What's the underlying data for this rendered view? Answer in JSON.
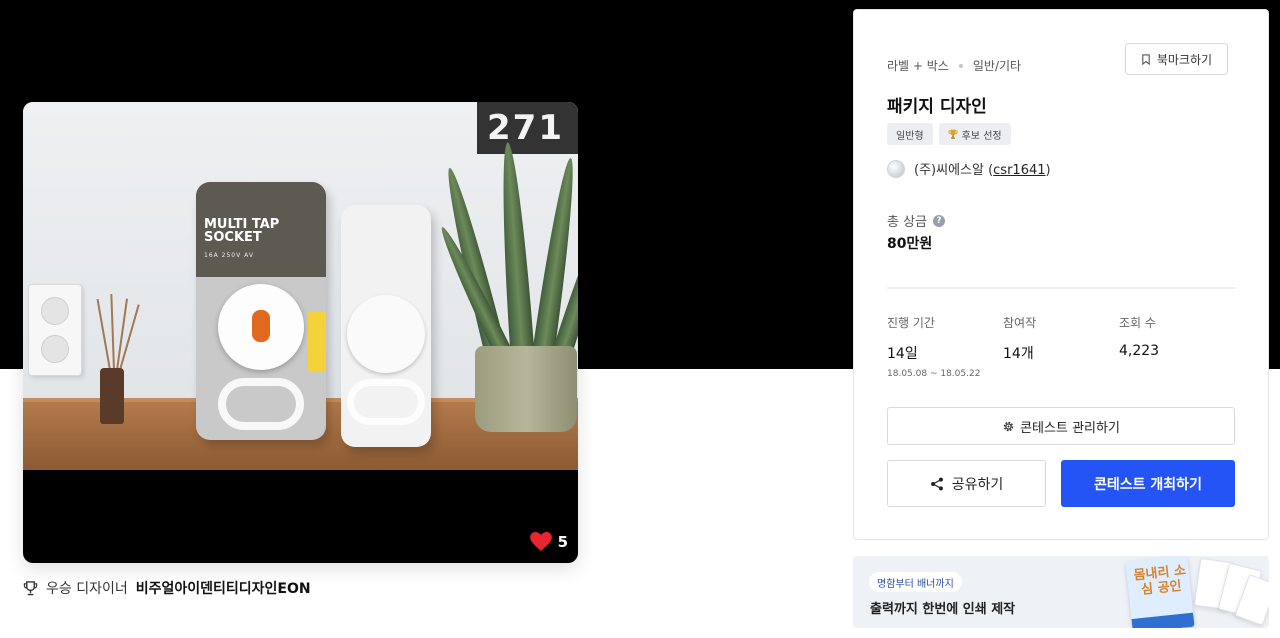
{
  "product": {
    "photo_clock_text": "271",
    "pack_title_line1": "MULTI TAP",
    "pack_title_line2": "SOCKET",
    "pack_subtitle": "16A 250V AV",
    "likes_count": "5"
  },
  "winner": {
    "label": "우승 디자이너",
    "name": "비주얼아이덴티티디자인EON"
  },
  "contest": {
    "category_primary": "라벨 + 박스",
    "category_secondary": "일반/기타",
    "bookmark_label": "북마크하기",
    "title": "패키지 디자인",
    "tags": [
      "일반형",
      "후보 선정"
    ],
    "host_name": "(주)씨에스알 (",
    "host_handle": "csr1641",
    "host_close": ")",
    "prize_label": "총 상금",
    "prize_value": "80만원",
    "stats": {
      "period_label": "진행 기간",
      "period_value": "14일",
      "period_range": "18.05.08 ~ 18.05.22",
      "entries_label": "참여작",
      "entries_value": "14개",
      "views_label": "조회 수",
      "views_value": "4,223"
    },
    "manage_label": "콘테스트 관리하기",
    "share_label": "공유하기",
    "host_contest_label": "콘테스트 개최하기"
  },
  "ad": {
    "pill_text": "명함부터 배너까지",
    "headline": "출력까지 한번에 인쇄 제작",
    "poster_text": "몸내리 소심 공인"
  },
  "colors": {
    "primary_button": "#2454f5",
    "heart": "#e8242f",
    "hero_band": "#000000"
  },
  "icons": [
    "heart-icon",
    "trophy-icon",
    "bookmark-icon",
    "gear-icon",
    "share-icon",
    "help-icon"
  ]
}
